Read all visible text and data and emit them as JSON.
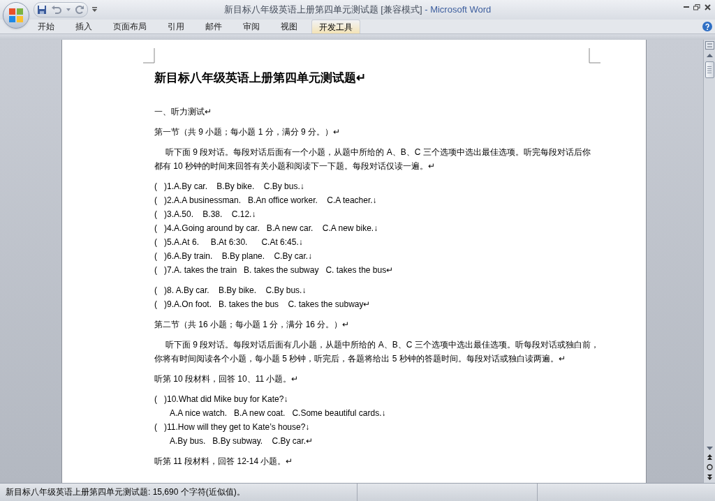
{
  "window": {
    "title": "新目标八年级英语上册第四单元测试题 [兼容模式]",
    "separator": "-",
    "app": "Microsoft Word"
  },
  "ribbon_tabs": [
    {
      "label": "开始",
      "selected": false
    },
    {
      "label": "插入",
      "selected": false
    },
    {
      "label": "页面布局",
      "selected": false
    },
    {
      "label": "引用",
      "selected": false
    },
    {
      "label": "邮件",
      "selected": false
    },
    {
      "label": "审阅",
      "selected": false
    },
    {
      "label": "视图",
      "selected": false
    },
    {
      "label": "开发工具",
      "selected": true
    }
  ],
  "document": {
    "blocks": [
      [
        {
          "kind": "title",
          "text": "新目标八年级英语上册第四单元测试题↵"
        }
      ],
      [
        {
          "kind": "text",
          "text": "一、听力测试↵"
        }
      ],
      [
        {
          "kind": "text",
          "text": "第一节（共 9 小题；每小题 1 分，满分 9 分。）↵"
        }
      ],
      [
        {
          "kind": "indent_first",
          "text": "听下面 9 段对话。每段对话后面有一个小题，从题中所给的 A、B、C 三个选项中选出最佳选项。听完每段对话后你"
        },
        {
          "kind": "text",
          "text": "都有 10 秒钟的时间来回答有关小题和阅读下一下题。每段对话仅读一遍。↵"
        }
      ],
      [
        {
          "kind": "question",
          "text": "(   )1.A.By car.    B.By bike.    C.By bus.↓"
        },
        {
          "kind": "question",
          "text": "(   )2.A.A businessman.   B.An office worker.    C.A teacher.↓"
        },
        {
          "kind": "question",
          "text": "(   )3.A.50.    B.38.    C.12.↓"
        },
        {
          "kind": "question",
          "text": "(   )4.A.Going around by car.   B.A new car.    C.A new bike.↓"
        },
        {
          "kind": "question",
          "text": "(   )5.A.At 6.     B.At 6:30.      C.At 6:45.↓"
        },
        {
          "kind": "question",
          "text": "(   )6.A.By train.    B.By plane.    C.By car.↓"
        },
        {
          "kind": "question",
          "text": "(   )7.A. takes the train   B. takes the subway   C. takes the bus↵"
        }
      ],
      [
        {
          "kind": "question",
          "text": "(   )8. A.By car.    B.By bike.    C.By bus.↓"
        },
        {
          "kind": "question",
          "text": "(   )9.A.On foot.   B. takes the bus    C. takes the subway↵"
        }
      ],
      [
        {
          "kind": "text",
          "text": "第二节（共 16 小题；每小题 1 分，满分 16 分。）↵"
        }
      ],
      [
        {
          "kind": "indent_first",
          "text": "听下面 9 段对话。每段对话后面有几小题，从题中所给的 A、B、C 三个选项中选出最佳选项。听每段对话或独白前，"
        },
        {
          "kind": "text",
          "text": "你将有时间阅读各个小题，每小题 5 秒钟，听完后，各题将给出 5 秒钟的答题时间。每段对话或独白读两遍。↵"
        }
      ],
      [
        {
          "kind": "text",
          "text": "听第 10 段材料，回答 10、11 小题。↵"
        }
      ],
      [
        {
          "kind": "question",
          "text": "(   )10.What did Mike buy for Kate?↓"
        },
        {
          "kind": "option",
          "text": "A.A nice watch.   B.A new coat.   C.Some beautiful cards.↓"
        },
        {
          "kind": "question",
          "text": "(   )11.How will they get to Kate’s house?↓"
        },
        {
          "kind": "option",
          "text": "A.By bus.   B.By subway.    C.By car.↵"
        }
      ],
      [
        {
          "kind": "text",
          "text": "听第 11 段材料，回答 12-14 小题。↵"
        }
      ]
    ]
  },
  "status_bar": {
    "text": "新目标八年级英语上册第四单元测试题: 15,690 个字符(近似值)。"
  }
}
